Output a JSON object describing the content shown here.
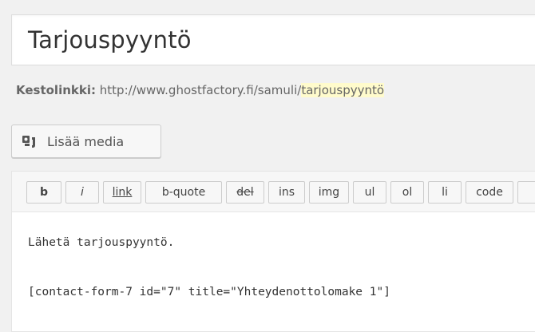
{
  "post": {
    "title": "Tarjouspyyntö"
  },
  "permalink": {
    "label": "Kestolinkki:",
    "base_url": "http://www.ghostfactory.fi/samuli/",
    "slug": "tarjouspyyntö"
  },
  "media_button": {
    "label": "Lisää media",
    "icon": "media-icon"
  },
  "quicktags": [
    {
      "label": "b"
    },
    {
      "label": "i"
    },
    {
      "label": "link"
    },
    {
      "label": "b-quote"
    },
    {
      "label": "del"
    },
    {
      "label": "ins"
    },
    {
      "label": "img"
    },
    {
      "label": "ul"
    },
    {
      "label": "ol"
    },
    {
      "label": "li"
    },
    {
      "label": "code"
    },
    {
      "label": ""
    }
  ],
  "editor": {
    "line1": "Lähetä tarjouspyyntö.",
    "line2": "[contact-form-7 id=\"7\" title=\"Yhteydenottolomake 1\"]"
  },
  "colors": {
    "background": "#f1f1f1",
    "slug_highlight": "#fffbcc"
  }
}
